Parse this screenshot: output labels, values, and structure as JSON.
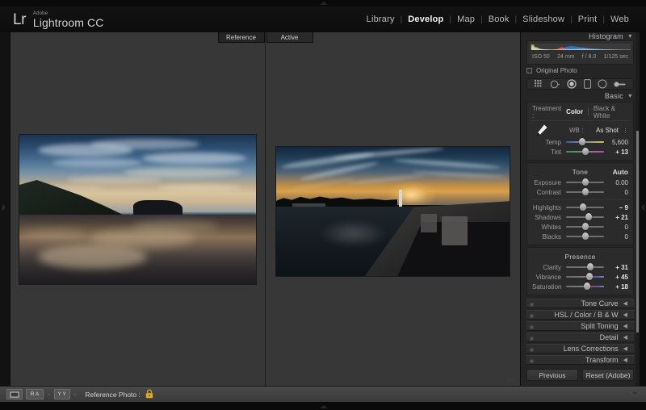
{
  "app": {
    "brand_mark": "Lr",
    "brand_company": "Adobe",
    "brand_product": "Lightroom CC",
    "accent": "#0a0a0a",
    "panel_bg": "#252525",
    "canvas_bg": "#373737"
  },
  "modules": [
    {
      "label": "Library",
      "active": false
    },
    {
      "label": "Develop",
      "active": true
    },
    {
      "label": "Map",
      "active": false
    },
    {
      "label": "Book",
      "active": false
    },
    {
      "label": "Slideshow",
      "active": false
    },
    {
      "label": "Print",
      "active": false
    },
    {
      "label": "Web",
      "active": false
    }
  ],
  "module_separator": "|",
  "canvas": {
    "tabs": [
      {
        "label": "Reference"
      },
      {
        "label": "Active"
      }
    ]
  },
  "histogram": {
    "title": "Histogram",
    "arrow": "▼",
    "iso": "ISO 50",
    "focal": "24 mm",
    "aperture": "f / 8.0",
    "shutter": "1/125 sec",
    "original_photo_label": "Original Photo",
    "original_photo_checked": false
  },
  "tools": [
    {
      "name": "crop-overlay-tool"
    },
    {
      "name": "spot-removal-tool"
    },
    {
      "name": "red-eye-tool"
    },
    {
      "name": "graduated-filter-tool"
    },
    {
      "name": "radial-filter-tool"
    },
    {
      "name": "adjustment-brush-tool"
    }
  ],
  "basic": {
    "title": "Basic",
    "arrow": "▼",
    "treatment_label": "Treatment :",
    "treatment_options": [
      {
        "label": "Color",
        "selected": true
      },
      {
        "label": "Black & White",
        "selected": false
      }
    ],
    "wb_label": "WB :",
    "wb_value": "As Shot",
    "wb_caret": "⋮",
    "white_balance": [
      {
        "name": "Temp",
        "value": "5,600",
        "pos": 43,
        "track": "temp"
      },
      {
        "name": "Tint",
        "value": "+ 13",
        "pos": 52,
        "track": "tint"
      }
    ],
    "tone_title": "Tone",
    "tone_auto": "Auto",
    "tone": [
      {
        "name": "Exposure",
        "value": "0.00",
        "pos": 50,
        "track": "plain",
        "bold": false
      },
      {
        "name": "Contrast",
        "value": "0",
        "pos": 50,
        "track": "plain",
        "bold": false
      }
    ],
    "tone2": [
      {
        "name": "Highlights",
        "value": "− 9",
        "pos": 45,
        "track": "plain",
        "bold": true
      },
      {
        "name": "Shadows",
        "value": "+ 21",
        "pos": 60,
        "track": "plain",
        "bold": true
      },
      {
        "name": "Whites",
        "value": "0",
        "pos": 50,
        "track": "plain",
        "bold": false
      },
      {
        "name": "Blacks",
        "value": "0",
        "pos": 50,
        "track": "plain",
        "bold": false
      }
    ],
    "presence_title": "Presence",
    "presence": [
      {
        "name": "Clarity",
        "value": "+ 31",
        "pos": 63,
        "track": "plain",
        "bold": true
      },
      {
        "name": "Vibrance",
        "value": "+ 45",
        "pos": 62,
        "track": "vib",
        "bold": true
      },
      {
        "name": "Saturation",
        "value": "+ 18",
        "pos": 55,
        "track": "sat",
        "bold": true
      }
    ]
  },
  "collapsed_panels": [
    {
      "label": "Tone Curve",
      "arrow": "◀"
    },
    {
      "label": "HSL / Color / B & W",
      "arrow": "◀"
    },
    {
      "label": "Split Toning",
      "arrow": "◀"
    },
    {
      "label": "Detail",
      "arrow": "◀"
    },
    {
      "label": "Lens Corrections",
      "arrow": "◀"
    },
    {
      "label": "Transform",
      "arrow": "◀"
    }
  ],
  "panel_buttons": {
    "previous": "Previous",
    "reset": "Reset (Adobe)"
  },
  "toolbar": {
    "view_loupe": "",
    "view_compare": "R A",
    "view_survey": "Y Y",
    "separator": "-",
    "reference_label": "Reference Photo :",
    "lock_icon": "lock-icon",
    "lock_color": "#d9a327"
  },
  "photos": {
    "reference": {
      "name": "beach-reflection-sunset"
    },
    "active": {
      "name": "harbor-pier-sunset"
    }
  }
}
